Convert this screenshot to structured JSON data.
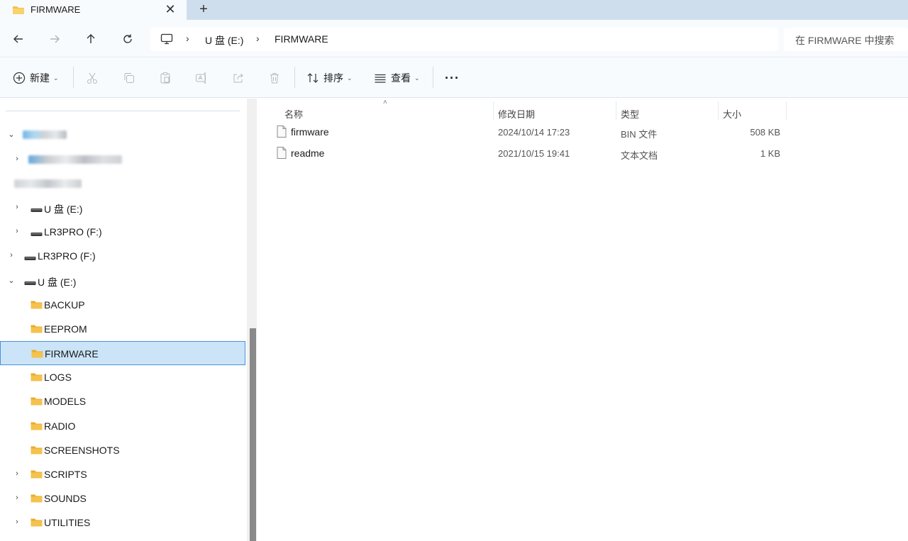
{
  "tab": {
    "title": "FIRMWARE",
    "close_icon": "✕",
    "new_tab_icon": "+"
  },
  "address": {
    "crumbs": [
      "U 盘 (E:)",
      "FIRMWARE"
    ],
    "search_placeholder": "在 FIRMWARE 中搜索"
  },
  "toolbar": {
    "new_label": "新建",
    "sort_label": "排序",
    "view_label": "查看",
    "more_label": "···"
  },
  "nav_tree": [
    {
      "label": "U 盘 (E:)",
      "icon": "drive-icon"
    },
    {
      "label": "LR3PRO (F:)",
      "icon": "drive-icon"
    },
    {
      "label": "LR3PRO (F:)",
      "icon": "drive-icon"
    },
    {
      "label": "U 盘 (E:)",
      "icon": "drive-icon"
    },
    {
      "label": "BACKUP",
      "icon": "folder-icon"
    },
    {
      "label": "EEPROM",
      "icon": "folder-icon"
    },
    {
      "label": "FIRMWARE",
      "icon": "folder-icon",
      "selected": true
    },
    {
      "label": "LOGS",
      "icon": "folder-icon"
    },
    {
      "label": "MODELS",
      "icon": "folder-icon"
    },
    {
      "label": "RADIO",
      "icon": "folder-icon"
    },
    {
      "label": "SCREENSHOTS",
      "icon": "folder-icon"
    },
    {
      "label": "SCRIPTS",
      "icon": "folder-icon"
    },
    {
      "label": "SOUNDS",
      "icon": "folder-icon"
    },
    {
      "label": "UTILITIES",
      "icon": "folder-icon"
    }
  ],
  "columns": {
    "name": "名称",
    "date": "修改日期",
    "type": "类型",
    "size": "大小"
  },
  "files": [
    {
      "name": "firmware",
      "date": "2024/10/14 17:23",
      "type": "BIN 文件",
      "size": "508 KB"
    },
    {
      "name": "readme",
      "date": "2021/10/15 19:41",
      "type": "文本文档",
      "size": "1 KB"
    }
  ],
  "colors": {
    "folder": "#f4c24d",
    "selected_bg": "#cce4f7",
    "selected_border": "#4a90d9"
  }
}
